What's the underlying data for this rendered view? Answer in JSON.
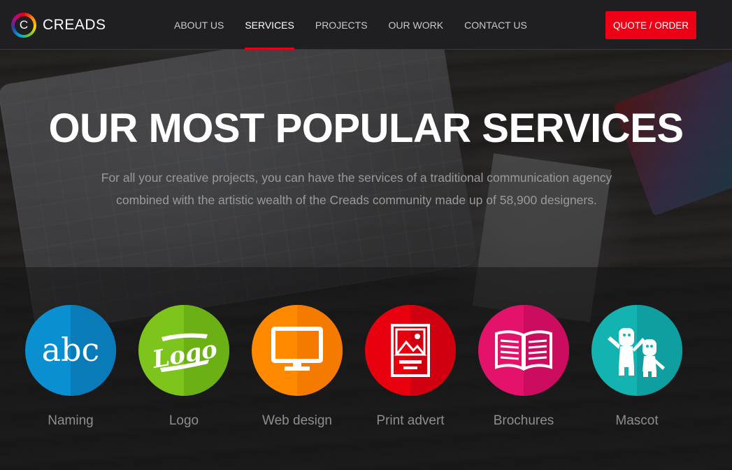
{
  "brand": {
    "logo_letter": "C",
    "name": "CREADS"
  },
  "nav": {
    "items": [
      {
        "label": "ABOUT US",
        "active": false
      },
      {
        "label": "SERVICES",
        "active": true
      },
      {
        "label": "PROJECTS",
        "active": false
      },
      {
        "label": "OUR WORK",
        "active": false
      },
      {
        "label": "CONTACT US",
        "active": false
      }
    ],
    "cta_label": "QUOTE / ORDER"
  },
  "hero": {
    "title": "OUR MOST POPULAR SERVICES",
    "subtitle_line1": "For all your creative projects, you can have the services of a traditional communication agency",
    "subtitle_line2": "combined with the artistic wealth of the Creads community made up of 58,900 designers."
  },
  "services": [
    {
      "label": "Naming",
      "icon": "abc-icon",
      "color": "#0a8fd1",
      "shade": "#0a7bb9",
      "icon_text": "abc"
    },
    {
      "label": "Logo",
      "icon": "logo-icon",
      "color": "#7dc41d",
      "shade": "#6bb014",
      "icon_text": "Logo"
    },
    {
      "label": "Web design",
      "icon": "monitor-icon",
      "color": "#ff8a00",
      "shade": "#f47b00"
    },
    {
      "label": "Print advert",
      "icon": "print-advert-icon",
      "color": "#e8000e",
      "shade": "#d10010"
    },
    {
      "label": "Brochures",
      "icon": "book-icon",
      "color": "#e3126b",
      "shade": "#cc0d5f"
    },
    {
      "label": "Mascot",
      "icon": "mascot-icon",
      "color": "#12b3b0",
      "shade": "#0f9fa0"
    }
  ],
  "colors": {
    "accent": "#ed0016",
    "nav_bg": "#1f1f21"
  }
}
